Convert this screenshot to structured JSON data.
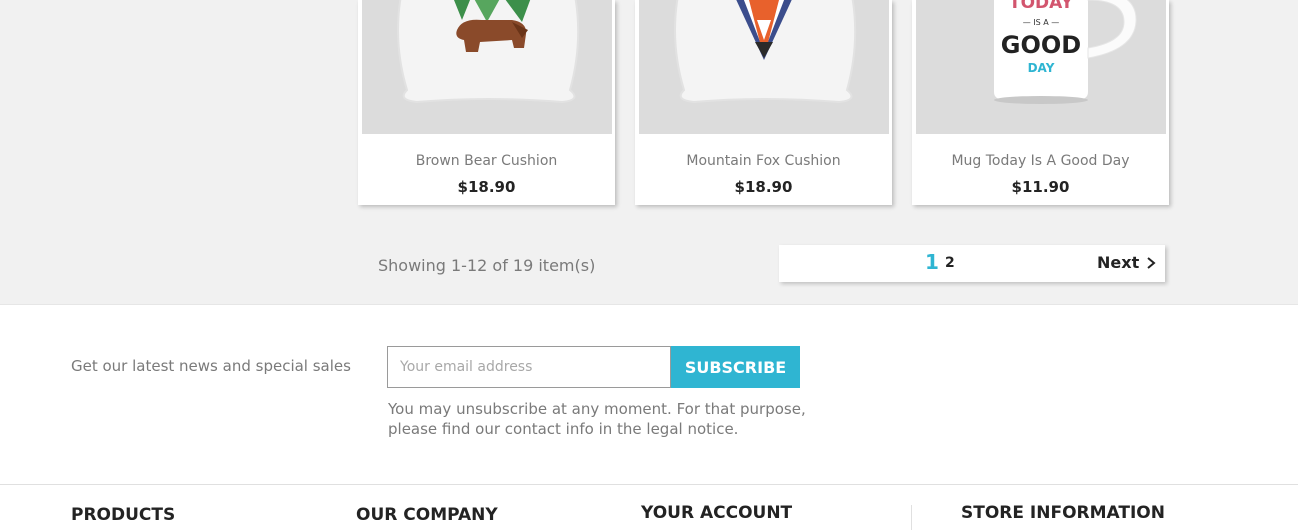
{
  "products": [
    {
      "name": "Brown Bear Cushion",
      "price": "$18.90",
      "image": "brown-bear-cushion-image"
    },
    {
      "name": "Mountain Fox Cushion",
      "price": "$18.90",
      "image": "mountain-fox-cushion-image"
    },
    {
      "name": "Mug Today Is A Good Day",
      "price": "$11.90",
      "image": "mug-image"
    }
  ],
  "mug_art": {
    "line1": "TODAY",
    "line2": "— IS A —",
    "line3": "GOOD",
    "line4": "DAY"
  },
  "listing": {
    "showing": "Showing 1-12 of 19 item(s)"
  },
  "pagination": {
    "current": "1",
    "page2": "2",
    "next": "Next",
    "next_icon": "chevron-right-icon"
  },
  "newsletter": {
    "text": "Get our latest news and special sales",
    "placeholder": "Your email address",
    "button": "Subscribe",
    "legal": "You may unsubscribe at any moment. For that purpose, please find our contact info in the legal notice."
  },
  "footer": {
    "products": "Products",
    "our_company": "Our company",
    "your_account": "Your account",
    "store_information": "Store information"
  },
  "colors": {
    "accent": "#2fb5d2",
    "background": "#f1f1f1",
    "text": "#7a7a7a",
    "dark": "#232323"
  }
}
